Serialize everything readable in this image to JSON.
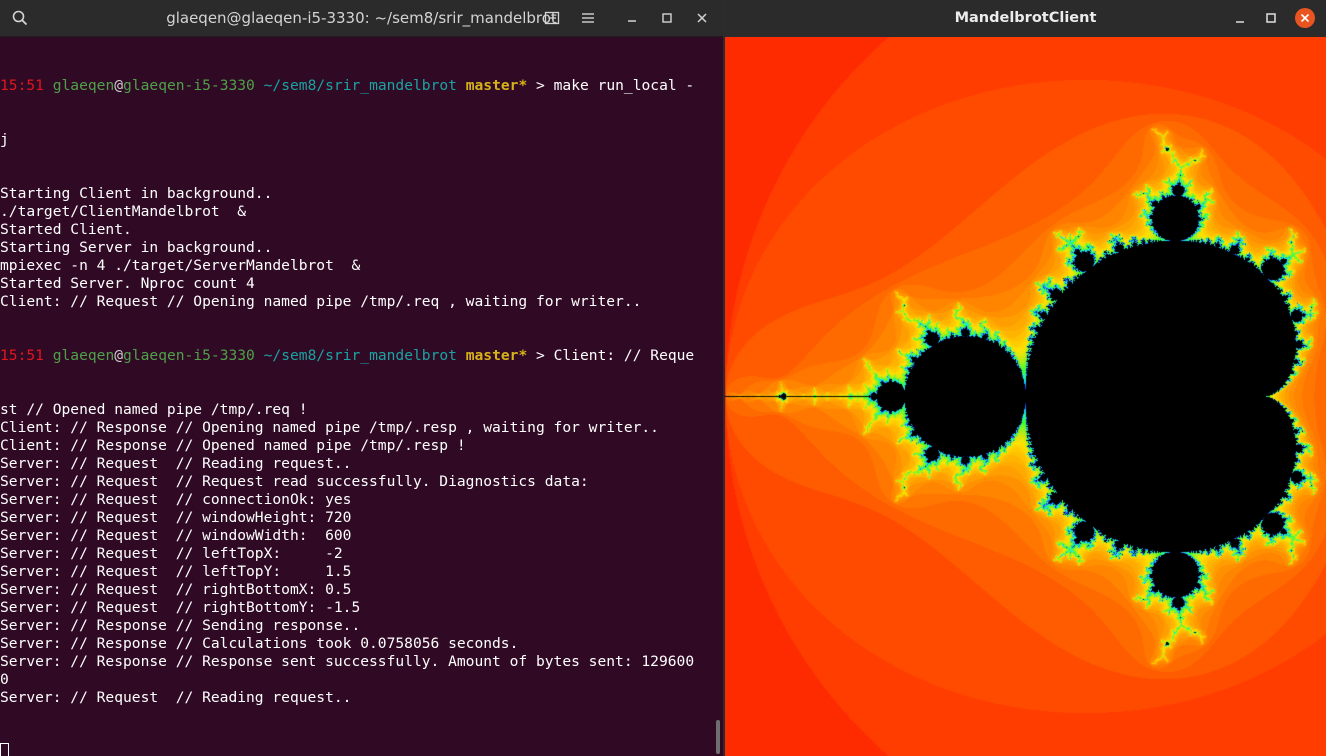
{
  "terminal": {
    "title": "glaeqen@glaeqen-i5-3330: ~/sem8/srir_mandelbrot",
    "prompt": {
      "time": "15:51",
      "user": "glaeqen",
      "at": "@",
      "host": "glaeqen-i5-3330",
      "path": "~/sem8/srir_mandelbrot",
      "branch": "master*",
      "symbol": ">"
    },
    "first_command": "make run_local -",
    "first_command_wrap": "j",
    "output_block_1": [
      "Starting Client in background..",
      "./target/ClientMandelbrot  &",
      "Started Client.",
      "Starting Server in background..",
      "mpiexec -n 4 ./target/ServerMandelbrot  &",
      "Started Server. Nproc count 4",
      "Client: // Request // Opening named pipe /tmp/.req , waiting for writer.."
    ],
    "second_prompt_text": "Client: // Reque",
    "output_block_2": [
      "st // Opened named pipe /tmp/.req !",
      "Client: // Response // Opening named pipe /tmp/.resp , waiting for writer..",
      "Client: // Response // Opened named pipe /tmp/.resp !",
      "Server: // Request  // Reading request..",
      "Server: // Request  // Request read successfully. Diagnostics data:",
      "Server: // Request  // connectionOk: yes",
      "Server: // Request  // windowHeight: 720",
      "Server: // Request  // windowWidth:  600",
      "Server: // Request  // leftTopX:     -2",
      "Server: // Request  // leftTopY:     1.5",
      "Server: // Request  // rightBottomX: 0.5",
      "Server: // Request  // rightBottomY: -1.5",
      "Server: // Response // Sending response..",
      "Server: // Response // Calculations took 0.0758056 seconds.",
      "Server: // Response // Response sent successfully. Amount of bytes sent: 129600",
      "0",
      "Server: // Request  // Reading request.."
    ],
    "icons": [
      "search-icon",
      "new-tab-icon",
      "menu-icon",
      "minimize-icon",
      "maximize-icon",
      "close-icon"
    ]
  },
  "mandelbrot_window": {
    "title": "MandelbrotClient",
    "icons": [
      "minimize-icon",
      "maximize-icon",
      "close-icon"
    ],
    "close_color": "#e95420",
    "region": {
      "leftTopX": -2,
      "leftTopY": 1.5,
      "rightBottomX": 0.5,
      "rightBottomY": -1.5
    },
    "colors": {
      "set": "#000000",
      "outer": "#ff2400",
      "mid": "#ff8c00",
      "near": "#ffe100",
      "edge": "#39ff3a"
    }
  }
}
